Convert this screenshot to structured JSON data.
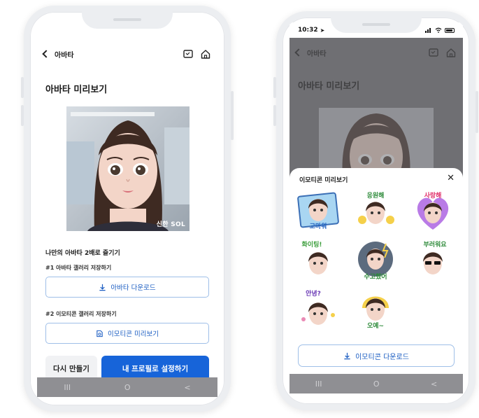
{
  "left_phone": {
    "header": {
      "back_label": "아바타"
    },
    "page_title": "아바타 미리보기",
    "brand_mark": "신한 SOL",
    "section_title": "나만의 아바타 2배로 즐기기",
    "step1": {
      "label": "#1 아바타 갤러리 저장하기",
      "button": "아바타 다운로드"
    },
    "step2": {
      "label": "#2 이모티콘 갤러리 저장하기",
      "button": "이모티콘 미리보기"
    },
    "actions": {
      "retry": "다시 만들기",
      "set_profile": "내 프로필로 설정하기"
    },
    "nav": {
      "recent": "III",
      "home": "O",
      "back": "<"
    }
  },
  "right_phone": {
    "status_bar": {
      "time": "10:32"
    },
    "header": {
      "back_label": "아바타"
    },
    "page_title": "아바타 미리보기",
    "sheet": {
      "title": "이모티콘 미리보기",
      "close": "✕",
      "emoticons": [
        {
          "text": "고마워"
        },
        {
          "text": "응원해"
        },
        {
          "text": "사랑해"
        },
        {
          "text": "화이팅!"
        },
        {
          "text": "수고했어"
        },
        {
          "text": "부러워요"
        },
        {
          "text": "안녕?"
        },
        {
          "text": "오예~"
        }
      ],
      "download_button": "이모티콘 다운로드"
    },
    "nav": {
      "recent": "III",
      "home": "O",
      "back": "<"
    }
  },
  "colors": {
    "primary": "#1764d9",
    "link": "#1a5cc2",
    "outline": "#9fbfe8",
    "dim": "#6f6f73",
    "nav": "#8f8f93"
  },
  "icons": [
    "back-chevron-icon",
    "chat-icon",
    "home-icon",
    "download-icon",
    "emoji-preview-icon",
    "close-icon",
    "battery-icon",
    "wifi-icon",
    "signal-icon"
  ]
}
